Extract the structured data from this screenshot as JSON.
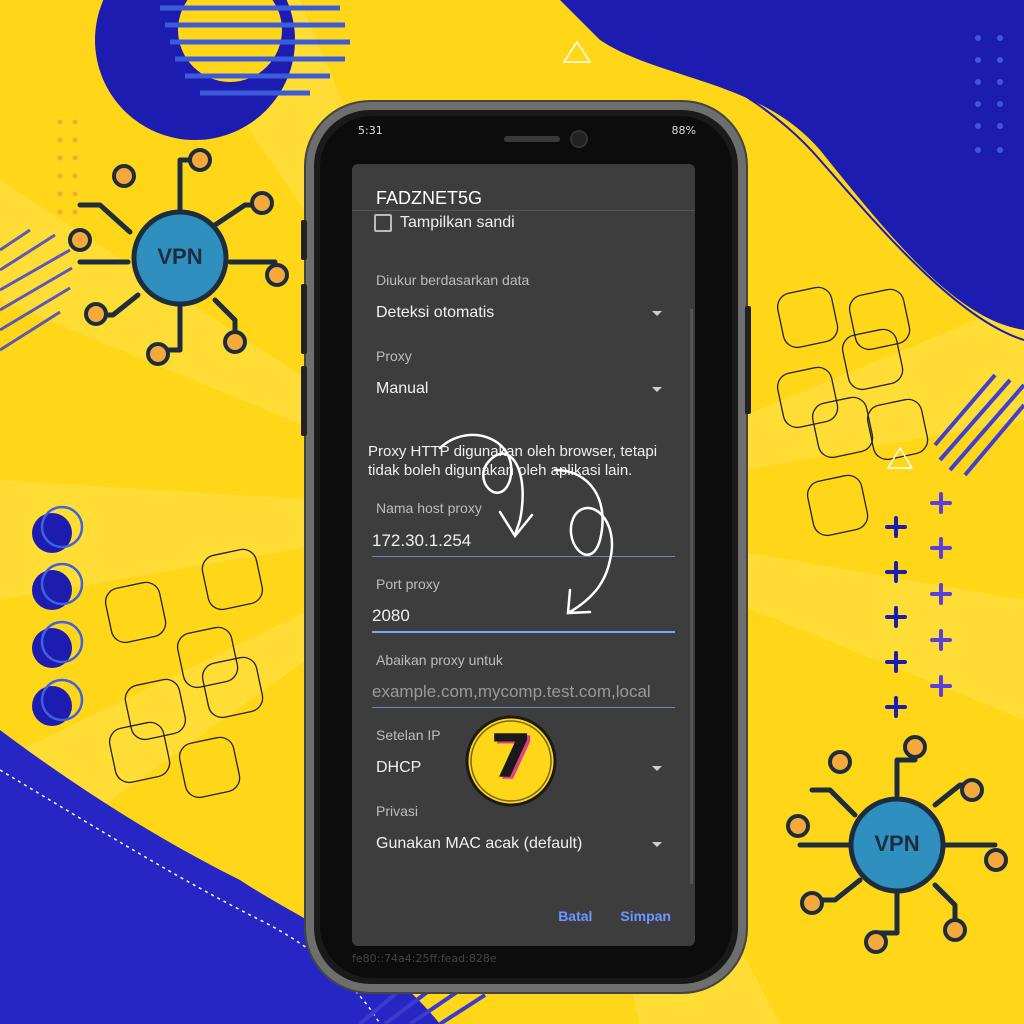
{
  "background": {
    "colors": {
      "yellow": "#ffd718",
      "navy": "#1c1cb0",
      "blue": "#2f4fd0",
      "teal": "#2f8fbf",
      "orange": "#f4a93a"
    },
    "vpn_badges": [
      {
        "label": "VPN"
      },
      {
        "label": "VPN"
      }
    ]
  },
  "status_bar": {
    "time": "5:31",
    "battery": "88%"
  },
  "dialog": {
    "title": "FADZNET5G",
    "show_password_label": "Tampilkan sandi",
    "metered": {
      "label": "Diukur berdasarkan data",
      "value": "Deteksi otomatis"
    },
    "proxy": {
      "label": "Proxy",
      "value": "Manual"
    },
    "proxy_note": "Proxy HTTP digunakan oleh browser, tetapi tidak boleh digunakan oleh aplikasi lain.",
    "proxy_host": {
      "label": "Nama host proxy",
      "value": "172.30.1.254"
    },
    "proxy_port": {
      "label": "Port proxy",
      "value": "2080"
    },
    "bypass": {
      "label": "Abaikan proxy untuk",
      "placeholder": "example.com,mycomp.test.com,local"
    },
    "ip_settings": {
      "label": "Setelan IP",
      "value": "DHCP"
    },
    "privacy": {
      "label": "Privasi",
      "value": "Gunakan MAC acak (default)"
    },
    "cancel_label": "Batal",
    "save_label": "Simpan"
  },
  "step_badge": {
    "number": "7"
  },
  "footer_mac": "fe80::74a4:25ff:fead:828e"
}
